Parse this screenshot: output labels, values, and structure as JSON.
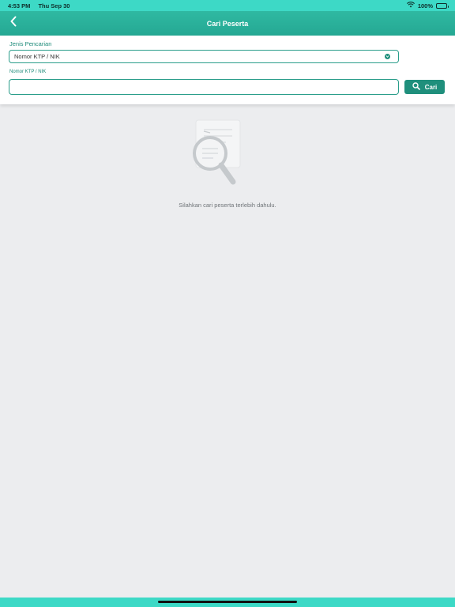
{
  "status_bar": {
    "time": "4:53 PM",
    "date": "Thu Sep 30",
    "battery": "100%",
    "icons": [
      "wifi-icon",
      "battery-icon"
    ]
  },
  "nav": {
    "title": "Cari Peserta",
    "back_icon": "chevron-left-icon"
  },
  "search_form": {
    "type_label": "Jenis Pencarian",
    "type_value": "Nomor KTP / NIK",
    "input_label": "Nomor KTP / NIK",
    "input_value": "",
    "button_label": "Cari",
    "button_icon": "search-icon"
  },
  "empty_state": {
    "icon": "magnifier-document-icon",
    "message": "Silahkan cari peserta terlebih dahulu."
  },
  "colors": {
    "accent": "#1f8f7c",
    "status_bar": "#3dd9c6",
    "nav_bar": "#2aae98",
    "background": "#ecedef"
  }
}
